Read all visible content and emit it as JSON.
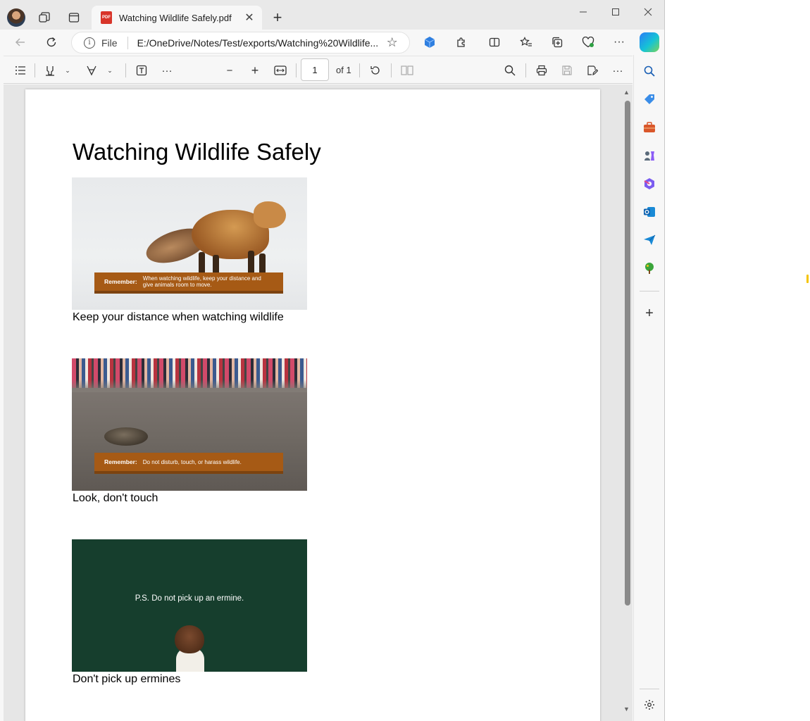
{
  "tab": {
    "title": "Watching Wildlife Safely.pdf",
    "pdf_badge": "PDF"
  },
  "address": {
    "scheme_label": "File",
    "url": "E:/OneDrive/Notes/Test/exports/Watching%20Wildlife..."
  },
  "pdf_toolbar": {
    "page_number": "1",
    "page_total": "of 1"
  },
  "document": {
    "title": "Watching Wildlife Safely",
    "sections": [
      {
        "banner_label": "Remember:",
        "banner_text": "When watching wildlife, keep your distance and give animals room to move.",
        "caption": "Keep your distance when watching wildlife"
      },
      {
        "banner_label": "Remember:",
        "banner_text": "Do not disturb, touch, or harass wildlife.",
        "caption": "Look, don't touch"
      },
      {
        "image_text": "P.S. Do not pick up an ermine.",
        "caption": "Don't pick up ermines"
      }
    ]
  },
  "colors": {
    "banner": "#a65a15",
    "ermine_bg": "#163e2d",
    "pdf_red": "#d8352a"
  }
}
